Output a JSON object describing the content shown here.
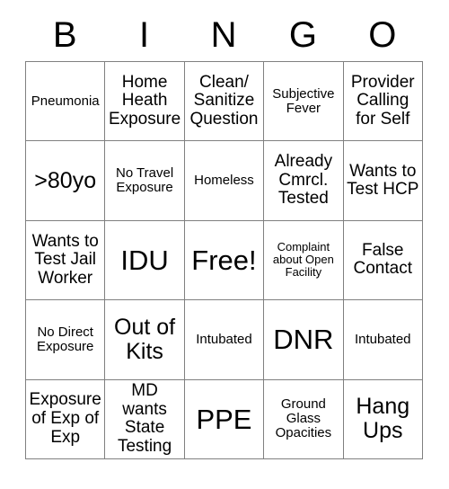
{
  "card": {
    "headers": [
      "B",
      "I",
      "N",
      "G",
      "O"
    ],
    "rows": [
      [
        {
          "text": "Pneumonia",
          "size": "sm"
        },
        {
          "text": "Home Heath Exposure",
          "size": "md"
        },
        {
          "text": "Clean/ Sanitize Question",
          "size": "md"
        },
        {
          "text": "Subjective Fever",
          "size": "sm"
        },
        {
          "text": "Provider Calling for Self",
          "size": "md"
        }
      ],
      [
        {
          "text": ">80yo",
          "size": "lg"
        },
        {
          "text": "No Travel Exposure",
          "size": "sm"
        },
        {
          "text": "Homeless",
          "size": "sm"
        },
        {
          "text": "Already Cmrcl. Tested",
          "size": "md"
        },
        {
          "text": "Wants to Test HCP",
          "size": "md"
        }
      ],
      [
        {
          "text": "Wants to Test Jail Worker",
          "size": "md"
        },
        {
          "text": "IDU",
          "size": "xl"
        },
        {
          "text": "Free!",
          "size": "xl"
        },
        {
          "text": "Complaint about Open Facility",
          "size": "xs"
        },
        {
          "text": "False Contact",
          "size": "md"
        }
      ],
      [
        {
          "text": "No Direct Exposure",
          "size": "sm"
        },
        {
          "text": "Out of Kits",
          "size": "lg"
        },
        {
          "text": "Intubated",
          "size": "sm"
        },
        {
          "text": "DNR",
          "size": "xl"
        },
        {
          "text": "Intubated",
          "size": "sm"
        }
      ],
      [
        {
          "text": "Exposure of Exp of Exp",
          "size": "md"
        },
        {
          "text": "MD wants State Testing",
          "size": "md"
        },
        {
          "text": "PPE",
          "size": "xl"
        },
        {
          "text": "Ground Glass Opacities",
          "size": "sm"
        },
        {
          "text": "Hang Ups",
          "size": "lg"
        }
      ]
    ],
    "colors": {
      "background": "#ffffff",
      "text": "#000000",
      "grid_line": "#808080"
    }
  }
}
